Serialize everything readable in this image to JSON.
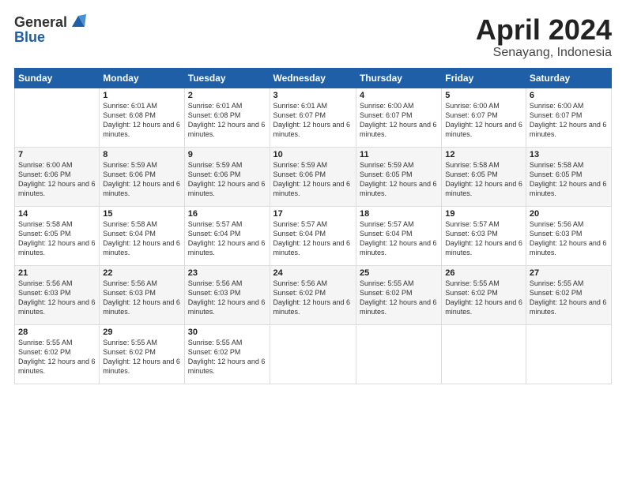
{
  "logo": {
    "general": "General",
    "blue": "Blue"
  },
  "header": {
    "month": "April 2024",
    "location": "Senayang, Indonesia"
  },
  "weekdays": [
    "Sunday",
    "Monday",
    "Tuesday",
    "Wednesday",
    "Thursday",
    "Friday",
    "Saturday"
  ],
  "rows": [
    [
      {
        "day": "",
        "sunrise": "",
        "sunset": "",
        "daylight": ""
      },
      {
        "day": "1",
        "sunrise": "Sunrise: 6:01 AM",
        "sunset": "Sunset: 6:08 PM",
        "daylight": "Daylight: 12 hours and 6 minutes."
      },
      {
        "day": "2",
        "sunrise": "Sunrise: 6:01 AM",
        "sunset": "Sunset: 6:08 PM",
        "daylight": "Daylight: 12 hours and 6 minutes."
      },
      {
        "day": "3",
        "sunrise": "Sunrise: 6:01 AM",
        "sunset": "Sunset: 6:07 PM",
        "daylight": "Daylight: 12 hours and 6 minutes."
      },
      {
        "day": "4",
        "sunrise": "Sunrise: 6:00 AM",
        "sunset": "Sunset: 6:07 PM",
        "daylight": "Daylight: 12 hours and 6 minutes."
      },
      {
        "day": "5",
        "sunrise": "Sunrise: 6:00 AM",
        "sunset": "Sunset: 6:07 PM",
        "daylight": "Daylight: 12 hours and 6 minutes."
      },
      {
        "day": "6",
        "sunrise": "Sunrise: 6:00 AM",
        "sunset": "Sunset: 6:07 PM",
        "daylight": "Daylight: 12 hours and 6 minutes."
      }
    ],
    [
      {
        "day": "7",
        "sunrise": "Sunrise: 6:00 AM",
        "sunset": "Sunset: 6:06 PM",
        "daylight": "Daylight: 12 hours and 6 minutes."
      },
      {
        "day": "8",
        "sunrise": "Sunrise: 5:59 AM",
        "sunset": "Sunset: 6:06 PM",
        "daylight": "Daylight: 12 hours and 6 minutes."
      },
      {
        "day": "9",
        "sunrise": "Sunrise: 5:59 AM",
        "sunset": "Sunset: 6:06 PM",
        "daylight": "Daylight: 12 hours and 6 minutes."
      },
      {
        "day": "10",
        "sunrise": "Sunrise: 5:59 AM",
        "sunset": "Sunset: 6:06 PM",
        "daylight": "Daylight: 12 hours and 6 minutes."
      },
      {
        "day": "11",
        "sunrise": "Sunrise: 5:59 AM",
        "sunset": "Sunset: 6:05 PM",
        "daylight": "Daylight: 12 hours and 6 minutes."
      },
      {
        "day": "12",
        "sunrise": "Sunrise: 5:58 AM",
        "sunset": "Sunset: 6:05 PM",
        "daylight": "Daylight: 12 hours and 6 minutes."
      },
      {
        "day": "13",
        "sunrise": "Sunrise: 5:58 AM",
        "sunset": "Sunset: 6:05 PM",
        "daylight": "Daylight: 12 hours and 6 minutes."
      }
    ],
    [
      {
        "day": "14",
        "sunrise": "Sunrise: 5:58 AM",
        "sunset": "Sunset: 6:05 PM",
        "daylight": "Daylight: 12 hours and 6 minutes."
      },
      {
        "day": "15",
        "sunrise": "Sunrise: 5:58 AM",
        "sunset": "Sunset: 6:04 PM",
        "daylight": "Daylight: 12 hours and 6 minutes."
      },
      {
        "day": "16",
        "sunrise": "Sunrise: 5:57 AM",
        "sunset": "Sunset: 6:04 PM",
        "daylight": "Daylight: 12 hours and 6 minutes."
      },
      {
        "day": "17",
        "sunrise": "Sunrise: 5:57 AM",
        "sunset": "Sunset: 6:04 PM",
        "daylight": "Daylight: 12 hours and 6 minutes."
      },
      {
        "day": "18",
        "sunrise": "Sunrise: 5:57 AM",
        "sunset": "Sunset: 6:04 PM",
        "daylight": "Daylight: 12 hours and 6 minutes."
      },
      {
        "day": "19",
        "sunrise": "Sunrise: 5:57 AM",
        "sunset": "Sunset: 6:03 PM",
        "daylight": "Daylight: 12 hours and 6 minutes."
      },
      {
        "day": "20",
        "sunrise": "Sunrise: 5:56 AM",
        "sunset": "Sunset: 6:03 PM",
        "daylight": "Daylight: 12 hours and 6 minutes."
      }
    ],
    [
      {
        "day": "21",
        "sunrise": "Sunrise: 5:56 AM",
        "sunset": "Sunset: 6:03 PM",
        "daylight": "Daylight: 12 hours and 6 minutes."
      },
      {
        "day": "22",
        "sunrise": "Sunrise: 5:56 AM",
        "sunset": "Sunset: 6:03 PM",
        "daylight": "Daylight: 12 hours and 6 minutes."
      },
      {
        "day": "23",
        "sunrise": "Sunrise: 5:56 AM",
        "sunset": "Sunset: 6:03 PM",
        "daylight": "Daylight: 12 hours and 6 minutes."
      },
      {
        "day": "24",
        "sunrise": "Sunrise: 5:56 AM",
        "sunset": "Sunset: 6:02 PM",
        "daylight": "Daylight: 12 hours and 6 minutes."
      },
      {
        "day": "25",
        "sunrise": "Sunrise: 5:55 AM",
        "sunset": "Sunset: 6:02 PM",
        "daylight": "Daylight: 12 hours and 6 minutes."
      },
      {
        "day": "26",
        "sunrise": "Sunrise: 5:55 AM",
        "sunset": "Sunset: 6:02 PM",
        "daylight": "Daylight: 12 hours and 6 minutes."
      },
      {
        "day": "27",
        "sunrise": "Sunrise: 5:55 AM",
        "sunset": "Sunset: 6:02 PM",
        "daylight": "Daylight: 12 hours and 6 minutes."
      }
    ],
    [
      {
        "day": "28",
        "sunrise": "Sunrise: 5:55 AM",
        "sunset": "Sunset: 6:02 PM",
        "daylight": "Daylight: 12 hours and 6 minutes."
      },
      {
        "day": "29",
        "sunrise": "Sunrise: 5:55 AM",
        "sunset": "Sunset: 6:02 PM",
        "daylight": "Daylight: 12 hours and 6 minutes."
      },
      {
        "day": "30",
        "sunrise": "Sunrise: 5:55 AM",
        "sunset": "Sunset: 6:02 PM",
        "daylight": "Daylight: 12 hours and 6 minutes."
      },
      {
        "day": "",
        "sunrise": "",
        "sunset": "",
        "daylight": ""
      },
      {
        "day": "",
        "sunrise": "",
        "sunset": "",
        "daylight": ""
      },
      {
        "day": "",
        "sunrise": "",
        "sunset": "",
        "daylight": ""
      },
      {
        "day": "",
        "sunrise": "",
        "sunset": "",
        "daylight": ""
      }
    ]
  ]
}
